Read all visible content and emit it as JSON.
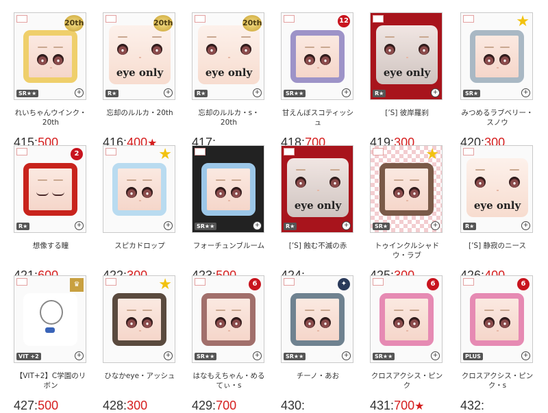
{
  "colors": {
    "price": "#d51e1e",
    "number": "#333333"
  },
  "items": [
    {
      "num": "415",
      "price": "500",
      "mark": "",
      "name": "れいちゃんウインク・20th",
      "badge": "20th",
      "rank": "SR★★",
      "frame": "#efcf6b",
      "style": "normal"
    },
    {
      "num": "416",
      "price": "400",
      "mark": "★",
      "name": "忘却のルルカ・20th",
      "badge": "20th",
      "rank": "R★",
      "frame": "#ffffff",
      "style": "eyeonly",
      "caption": "eye only"
    },
    {
      "num": "417",
      "price": "",
      "mark": "",
      "name": "忘却のルルカ・s・20th",
      "badge": "20th",
      "rank": "R★",
      "frame": "#ffffff",
      "style": "eyeonly",
      "caption": "eye only"
    },
    {
      "num": "418",
      "price": "700",
      "mark": "",
      "name": "甘えんぼスコティッシュ",
      "badge": "12",
      "rank": "SR★★",
      "frame": "#9d93c8",
      "style": "normal"
    },
    {
      "num": "419",
      "price": "300",
      "mark": "",
      "name": "[ʼS] 彼岸羅刹",
      "badge": "",
      "rank": "R★",
      "frame": "#ffffff",
      "style": "red",
      "caption": "eye only"
    },
    {
      "num": "420",
      "price": "300",
      "mark": "",
      "name": "みつめるラブベリー・スノウ",
      "badge": "star",
      "rank": "SR★",
      "frame": "#a9b8c4",
      "style": "normal"
    },
    {
      "num": "421",
      "price": "600",
      "mark": "",
      "name": "想像する瞳",
      "badge": "2",
      "rank": "R★",
      "frame": "#c8231c",
      "style": "closed"
    },
    {
      "num": "422",
      "price": "300",
      "mark": "",
      "name": "スピカドロップ",
      "badge": "star",
      "rank": "",
      "frame": "#b9dbf0",
      "style": "normal"
    },
    {
      "num": "423",
      "price": "500",
      "mark": "",
      "name": "フォーチュンブルーム",
      "badge": "",
      "rank": "SR★★",
      "frame": "#9cc7e8",
      "style": "dark"
    },
    {
      "num": "424",
      "price": "",
      "mark": "",
      "name": "[ʼS] 蝕む不滅の赤",
      "badge": "",
      "rank": "R★",
      "frame": "#ffffff",
      "style": "red",
      "caption": "eye only"
    },
    {
      "num": "425",
      "price": "300",
      "mark": "",
      "name": "トゥインクルシャドウ・ラブ",
      "badge": "star",
      "rank": "SR★",
      "frame": "#7a5a48",
      "style": "check"
    },
    {
      "num": "426",
      "price": "400",
      "mark": "",
      "name": "[ʼS] 静寂のニース",
      "badge": "",
      "rank": "R★",
      "frame": "#ffffff",
      "style": "eyeonly",
      "caption": "eye only"
    },
    {
      "num": "427",
      "price": "500",
      "mark": "",
      "name": "【VIT+2】C学園のリボン",
      "badge": "crown",
      "rank": "VIT +2",
      "frame": "#ffffff",
      "style": "silhouette"
    },
    {
      "num": "428",
      "price": "300",
      "mark": "",
      "name": "ひなかeye・アッシュ",
      "badge": "star",
      "rank": "",
      "frame": "#5a4a3e",
      "style": "normal"
    },
    {
      "num": "429",
      "price": "700",
      "mark": "",
      "name": "はなもえちゃん・めるてぃ・s",
      "badge": "6",
      "rank": "SR★★",
      "frame": "#a16f6b",
      "style": "normal"
    },
    {
      "num": "430",
      "price": "",
      "mark": "",
      "name": "チーノ・あお",
      "badge": "emblem",
      "rank": "SR★★",
      "frame": "#6f8290",
      "style": "plaid"
    },
    {
      "num": "431",
      "price": "700",
      "mark": "★",
      "name": "クロスアクシス・ピンク",
      "badge": "6",
      "rank": "SR★★",
      "frame": "#e68ab3",
      "style": "normal"
    },
    {
      "num": "432",
      "price": "",
      "mark": "",
      "name": "クロスアクシス・ピンク・s",
      "badge": "6",
      "rank": "PLUS",
      "frame": "#e68ab3",
      "style": "normal"
    }
  ]
}
